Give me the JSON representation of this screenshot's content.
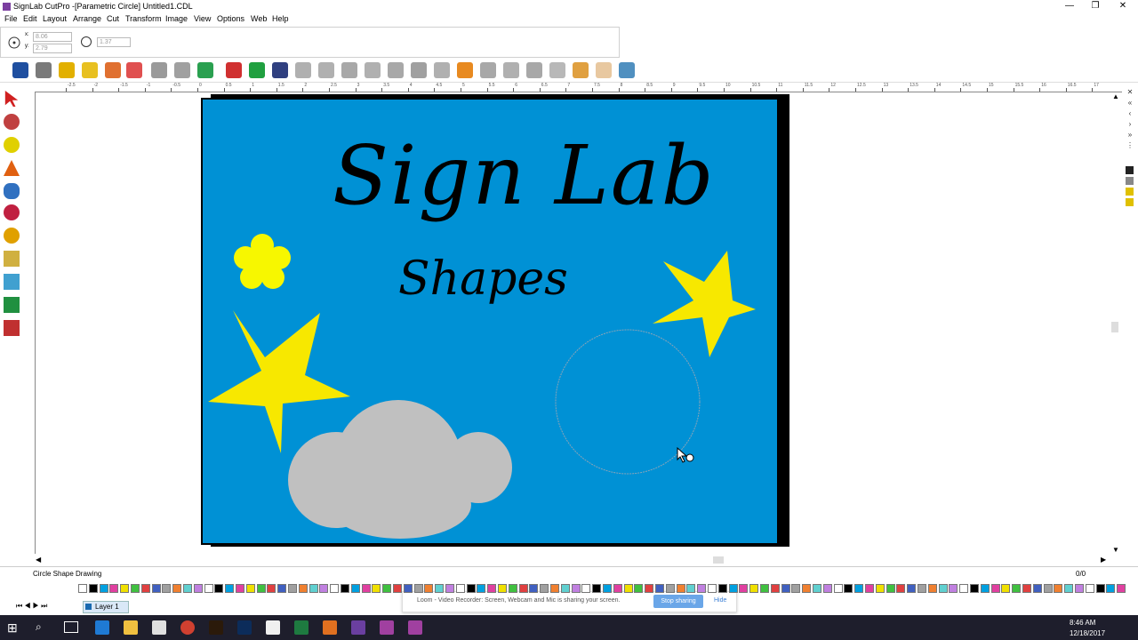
{
  "window": {
    "title": "SignLab CutPro -[Parametric Circle] Untitled1.CDL",
    "minimize": "—",
    "maximize": "❐",
    "close": "✕"
  },
  "menu": [
    "File",
    "Edit",
    "Layout",
    "Arrange",
    "Cut",
    "Transform",
    "Image",
    "View",
    "Options",
    "Web",
    "Help"
  ],
  "props": {
    "x_label": "x:",
    "x_value": "8.06",
    "y_label": "y:",
    "y_value": "2.79",
    "radius_value": "1.37"
  },
  "ruler_labels": [
    "-2.5",
    "-2",
    "-1.5",
    "-1",
    "-0.5",
    "0",
    "0.5",
    "1",
    "1.5",
    "2",
    "2.5",
    "3",
    "3.5",
    "4",
    "4.5",
    "5",
    "5.5",
    "6",
    "6.5",
    "7",
    "7.5",
    "8",
    "8.5",
    "9",
    "9.5",
    "10",
    "10.5",
    "11",
    "11.5",
    "12",
    "12.5",
    "13",
    "13.5",
    "14",
    "14.5",
    "15",
    "15.5",
    "16",
    "16.5",
    "17"
  ],
  "canvas": {
    "sign_color": "#0091d5",
    "title": "Sign Lab",
    "subtitle": "Shapes",
    "star_color": "#f7e800",
    "flower_color": "#f7f700",
    "cloud_color": "#c0c0c0"
  },
  "status": {
    "text": "Circle Shape Drawing",
    "page_counter": "0/0"
  },
  "layer": {
    "name": "Layer 1"
  },
  "loom": {
    "message": "Loom - Video Recorder: Screen, Webcam and Mic is sharing your screen.",
    "stop_button": "Stop sharing",
    "hide_button": "Hide"
  },
  "taskbar": {
    "time": "8:46 AM",
    "date": "12/18/2017"
  }
}
